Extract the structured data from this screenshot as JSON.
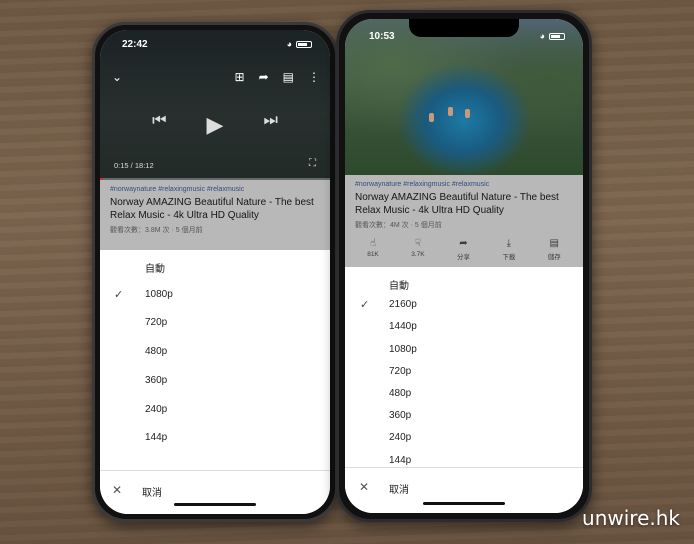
{
  "left_phone": {
    "time": "22:42",
    "player": {
      "time_display": "0:15 / 18:12",
      "progress": 0.014
    },
    "video": {
      "tags": "#norwaynature #relaxingmusic #relaxmusic",
      "title": "Norway AMAZING Beautiful Nature - The best Relax Music - 4k Ultra HD Quality",
      "meta": "觀看次數：3.8M 次 · 5 個月前"
    },
    "quality": {
      "options": [
        "自動",
        "1080p",
        "720p",
        "480p",
        "360p",
        "240p",
        "144p"
      ],
      "selected": "1080p",
      "cancel_label": "取消"
    }
  },
  "right_phone": {
    "time": "10:53",
    "video": {
      "tags": "#norwaynature #relaxingmusic #relaxmusic",
      "title": "Norway AMAZING Beautiful Nature - The best Relax Music - 4k Ultra HD Quality",
      "meta": "觀看次數：4M 次 · 5 個月前",
      "actions": [
        {
          "icon": "like-icon",
          "label": "81K"
        },
        {
          "icon": "dislike-icon",
          "label": "3.7K"
        },
        {
          "icon": "share-icon",
          "label": "分享"
        },
        {
          "icon": "download-icon",
          "label": "下載"
        },
        {
          "icon": "save-icon",
          "label": "儲存"
        }
      ]
    },
    "quality": {
      "options": [
        "自動",
        "2160p",
        "1440p",
        "1080p",
        "720p",
        "480p",
        "360p",
        "240p",
        "144p"
      ],
      "selected": "2160p",
      "cancel_label": "取消"
    }
  },
  "watermark": "unwire.hk"
}
